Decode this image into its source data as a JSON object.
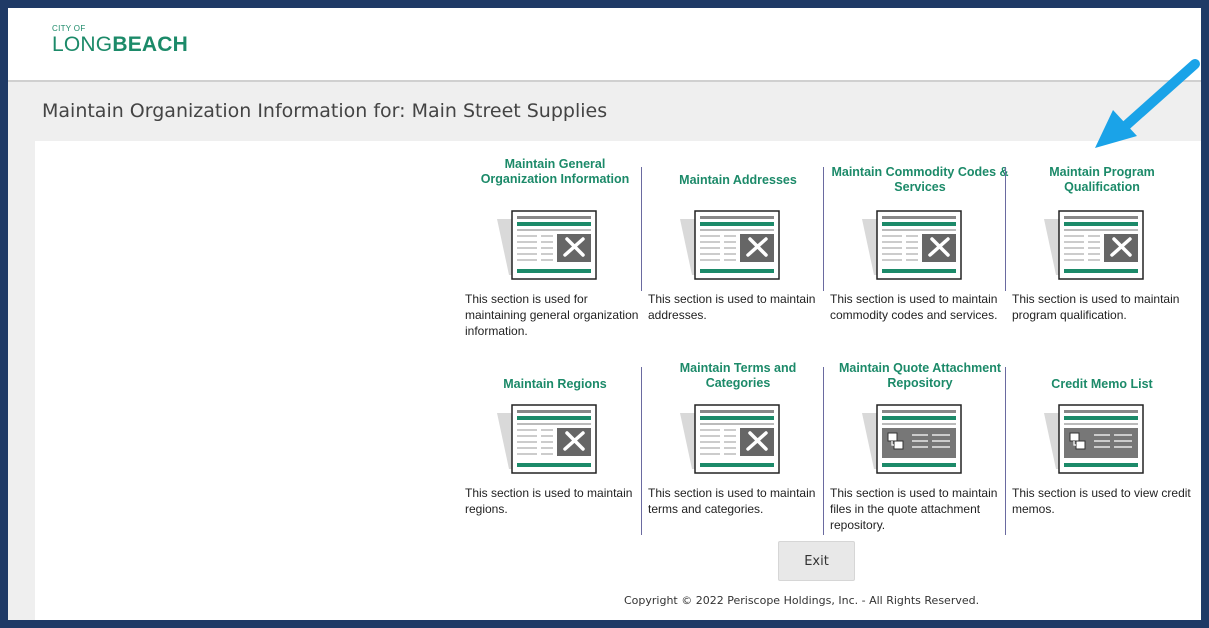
{
  "header": {
    "logo_top": "CITY OF",
    "logo_main_a": "LONG",
    "logo_main_b": "BEACH"
  },
  "page": {
    "title": "Maintain Organization Information for: Main Street Supplies"
  },
  "tiles": [
    {
      "title": "Maintain General Organization Information",
      "description": "This section is used for maintaining general organization information.",
      "icon": "form-tools-icon"
    },
    {
      "title": "Maintain Addresses",
      "description": "This section is used to maintain addresses.",
      "icon": "form-tools-icon"
    },
    {
      "title": "Maintain Commodity Codes & Services",
      "description": "This section is used to maintain commodity codes and services.",
      "icon": "form-tools-icon"
    },
    {
      "title": "Maintain Program Qualification",
      "description": "This section is used to maintain program qualification.",
      "icon": "form-tools-icon"
    },
    {
      "title": "Maintain Regions",
      "description": "This section is used to maintain regions.",
      "icon": "form-tools-icon"
    },
    {
      "title": "Maintain Terms and Categories",
      "description": "This section is used to maintain terms and categories.",
      "icon": "form-tools-icon"
    },
    {
      "title": "Maintain Quote Attachment Repository",
      "description": "This section is used to maintain files in the quote attachment repository.",
      "icon": "form-list-icon"
    },
    {
      "title": "Credit Memo List",
      "description": "This section is used to view credit memos.",
      "icon": "form-list-icon"
    }
  ],
  "actions": {
    "exit_label": "Exit"
  },
  "footer": {
    "copyright": "Copyright © 2022 Periscope Holdings, Inc. - All Rights Reserved."
  },
  "colors": {
    "accent": "#1c8a69",
    "frame": "#1f3a66",
    "annotation_arrow": "#1aa3e8"
  }
}
